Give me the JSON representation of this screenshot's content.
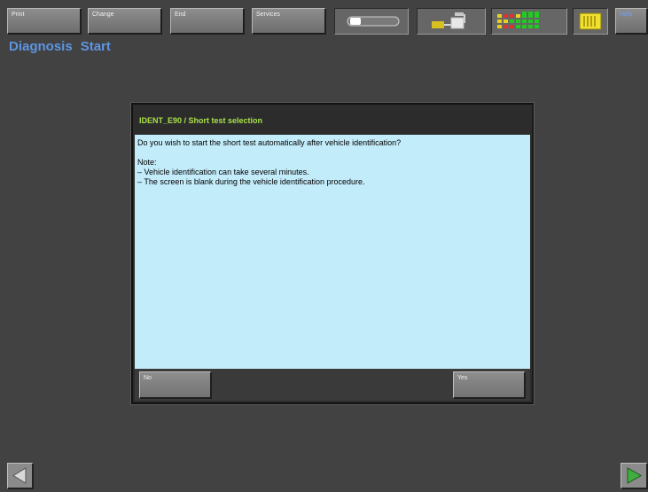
{
  "toolbar": {
    "print_label": "Print",
    "change_label": "Change",
    "end_label": "End",
    "services_label": "Services",
    "help_label": "Help"
  },
  "breadcrumb": {
    "item1": "Diagnosis",
    "item2": "Start"
  },
  "dialog": {
    "title": "IDENT_E90 / Short test selection",
    "question": "Do you wish to start the short test automatically after vehicle identification?",
    "note_heading": "Note:",
    "note_line1": "– Vehicle identification can take several minutes.",
    "note_line2": "– The screen is blank during the vehicle identification procedure.",
    "no_label": "No",
    "yes_label": "Yes"
  },
  "colors": {
    "background": "#424242",
    "breadcrumb": "#5e95e0",
    "dialog_title": "#a9e04a",
    "dialog_body": "#c3ecfa",
    "nav_arrow": "#3fae3f"
  },
  "icons": {
    "status_toggle": "toggle-indicator-icon",
    "connection": "vehicle-connection-icon",
    "signal": "signal-status-icon",
    "battery": "battery-icon",
    "back": "arrow-left-icon",
    "forward": "arrow-right-icon"
  }
}
